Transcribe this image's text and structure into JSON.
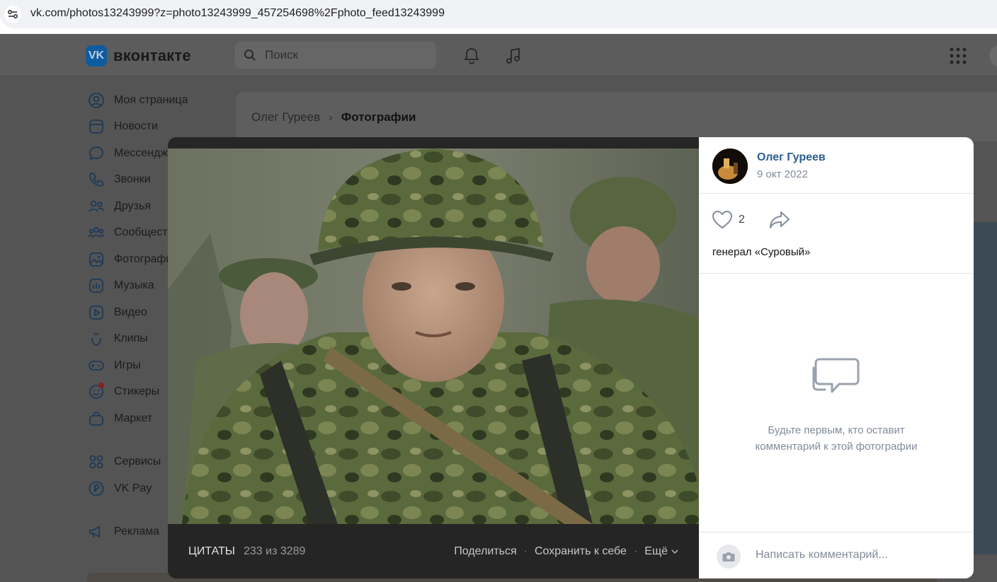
{
  "browser": {
    "url": "vk.com/photos13243999?z=photo13243999_457254698%2Fphoto_feed13243999"
  },
  "header": {
    "logo_text": "вконтакте",
    "logo_mark": "VK",
    "search_placeholder": "Поиск",
    "icons": [
      "notifications-bell-icon",
      "music-note-icon",
      "apps-grid-icon"
    ]
  },
  "sidebar": {
    "items": [
      {
        "label": "Моя страница",
        "icon": "user-icon"
      },
      {
        "label": "Новости",
        "icon": "news-icon"
      },
      {
        "label": "Мессенджер",
        "icon": "chat-icon"
      },
      {
        "label": "Звонки",
        "icon": "phone-icon"
      },
      {
        "label": "Друзья",
        "icon": "friends-icon"
      },
      {
        "label": "Сообщества",
        "icon": "communities-icon"
      },
      {
        "label": "Фотографии",
        "icon": "photos-icon"
      },
      {
        "label": "Музыка",
        "icon": "music-icon"
      },
      {
        "label": "Видео",
        "icon": "video-icon"
      },
      {
        "label": "Клипы",
        "icon": "clips-icon"
      },
      {
        "label": "Игры",
        "icon": "games-icon"
      },
      {
        "label": "Стикеры",
        "icon": "stickers-icon"
      },
      {
        "label": "Маркет",
        "icon": "market-icon"
      }
    ],
    "extra_items": [
      {
        "label": "Сервисы",
        "icon": "services-icon"
      },
      {
        "label": "VK Pay",
        "icon": "vkpay-icon"
      }
    ],
    "ads_item": {
      "label": "Реклама",
      "icon": "megaphone-icon"
    }
  },
  "breadcrumb": {
    "owner": "Олег Гуреев",
    "separator": "›",
    "current": "Фотографии"
  },
  "viewer": {
    "album": "ЦИТАТЫ",
    "counter": "233 из 3289",
    "actions": {
      "share": "Поделиться",
      "separator": "·",
      "save": "Сохранить к себе",
      "more": "Ещё"
    }
  },
  "post": {
    "author": "Олег Гуреев",
    "date": "9 окт 2022",
    "likes": "2",
    "caption": "генерал «Суровый»",
    "empty_comments_line1": "Будьте первым, кто оставит",
    "empty_comments_line2": "комментарий к этой фотографии",
    "comment_placeholder": "Написать комментарий..."
  },
  "colors": {
    "accent": "#2c5d8f",
    "muted": "#818c99",
    "viewer_bg": "#262626"
  }
}
